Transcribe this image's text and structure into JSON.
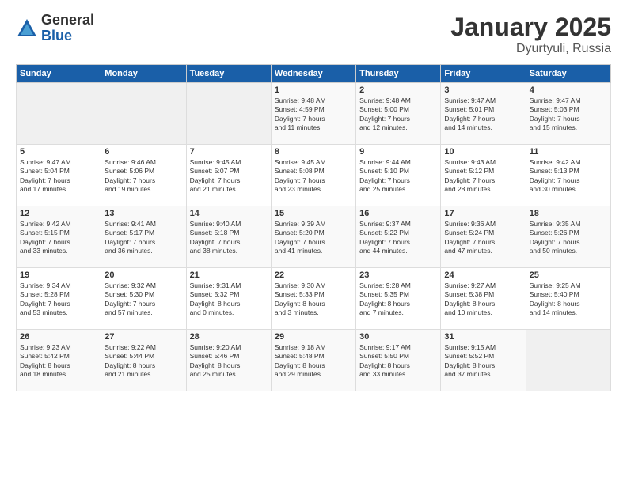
{
  "logo": {
    "general": "General",
    "blue": "Blue"
  },
  "title": "January 2025",
  "location": "Dyurtyuli, Russia",
  "days_header": [
    "Sunday",
    "Monday",
    "Tuesday",
    "Wednesday",
    "Thursday",
    "Friday",
    "Saturday"
  ],
  "weeks": [
    [
      {
        "day": "",
        "content": ""
      },
      {
        "day": "",
        "content": ""
      },
      {
        "day": "",
        "content": ""
      },
      {
        "day": "1",
        "content": "Sunrise: 9:48 AM\nSunset: 4:59 PM\nDaylight: 7 hours\nand 11 minutes."
      },
      {
        "day": "2",
        "content": "Sunrise: 9:48 AM\nSunset: 5:00 PM\nDaylight: 7 hours\nand 12 minutes."
      },
      {
        "day": "3",
        "content": "Sunrise: 9:47 AM\nSunset: 5:01 PM\nDaylight: 7 hours\nand 14 minutes."
      },
      {
        "day": "4",
        "content": "Sunrise: 9:47 AM\nSunset: 5:03 PM\nDaylight: 7 hours\nand 15 minutes."
      }
    ],
    [
      {
        "day": "5",
        "content": "Sunrise: 9:47 AM\nSunset: 5:04 PM\nDaylight: 7 hours\nand 17 minutes."
      },
      {
        "day": "6",
        "content": "Sunrise: 9:46 AM\nSunset: 5:06 PM\nDaylight: 7 hours\nand 19 minutes."
      },
      {
        "day": "7",
        "content": "Sunrise: 9:45 AM\nSunset: 5:07 PM\nDaylight: 7 hours\nand 21 minutes."
      },
      {
        "day": "8",
        "content": "Sunrise: 9:45 AM\nSunset: 5:08 PM\nDaylight: 7 hours\nand 23 minutes."
      },
      {
        "day": "9",
        "content": "Sunrise: 9:44 AM\nSunset: 5:10 PM\nDaylight: 7 hours\nand 25 minutes."
      },
      {
        "day": "10",
        "content": "Sunrise: 9:43 AM\nSunset: 5:12 PM\nDaylight: 7 hours\nand 28 minutes."
      },
      {
        "day": "11",
        "content": "Sunrise: 9:42 AM\nSunset: 5:13 PM\nDaylight: 7 hours\nand 30 minutes."
      }
    ],
    [
      {
        "day": "12",
        "content": "Sunrise: 9:42 AM\nSunset: 5:15 PM\nDaylight: 7 hours\nand 33 minutes."
      },
      {
        "day": "13",
        "content": "Sunrise: 9:41 AM\nSunset: 5:17 PM\nDaylight: 7 hours\nand 36 minutes."
      },
      {
        "day": "14",
        "content": "Sunrise: 9:40 AM\nSunset: 5:18 PM\nDaylight: 7 hours\nand 38 minutes."
      },
      {
        "day": "15",
        "content": "Sunrise: 9:39 AM\nSunset: 5:20 PM\nDaylight: 7 hours\nand 41 minutes."
      },
      {
        "day": "16",
        "content": "Sunrise: 9:37 AM\nSunset: 5:22 PM\nDaylight: 7 hours\nand 44 minutes."
      },
      {
        "day": "17",
        "content": "Sunrise: 9:36 AM\nSunset: 5:24 PM\nDaylight: 7 hours\nand 47 minutes."
      },
      {
        "day": "18",
        "content": "Sunrise: 9:35 AM\nSunset: 5:26 PM\nDaylight: 7 hours\nand 50 minutes."
      }
    ],
    [
      {
        "day": "19",
        "content": "Sunrise: 9:34 AM\nSunset: 5:28 PM\nDaylight: 7 hours\nand 53 minutes."
      },
      {
        "day": "20",
        "content": "Sunrise: 9:32 AM\nSunset: 5:30 PM\nDaylight: 7 hours\nand 57 minutes."
      },
      {
        "day": "21",
        "content": "Sunrise: 9:31 AM\nSunset: 5:32 PM\nDaylight: 8 hours\nand 0 minutes."
      },
      {
        "day": "22",
        "content": "Sunrise: 9:30 AM\nSunset: 5:33 PM\nDaylight: 8 hours\nand 3 minutes."
      },
      {
        "day": "23",
        "content": "Sunrise: 9:28 AM\nSunset: 5:35 PM\nDaylight: 8 hours\nand 7 minutes."
      },
      {
        "day": "24",
        "content": "Sunrise: 9:27 AM\nSunset: 5:38 PM\nDaylight: 8 hours\nand 10 minutes."
      },
      {
        "day": "25",
        "content": "Sunrise: 9:25 AM\nSunset: 5:40 PM\nDaylight: 8 hours\nand 14 minutes."
      }
    ],
    [
      {
        "day": "26",
        "content": "Sunrise: 9:23 AM\nSunset: 5:42 PM\nDaylight: 8 hours\nand 18 minutes."
      },
      {
        "day": "27",
        "content": "Sunrise: 9:22 AM\nSunset: 5:44 PM\nDaylight: 8 hours\nand 21 minutes."
      },
      {
        "day": "28",
        "content": "Sunrise: 9:20 AM\nSunset: 5:46 PM\nDaylight: 8 hours\nand 25 minutes."
      },
      {
        "day": "29",
        "content": "Sunrise: 9:18 AM\nSunset: 5:48 PM\nDaylight: 8 hours\nand 29 minutes."
      },
      {
        "day": "30",
        "content": "Sunrise: 9:17 AM\nSunset: 5:50 PM\nDaylight: 8 hours\nand 33 minutes."
      },
      {
        "day": "31",
        "content": "Sunrise: 9:15 AM\nSunset: 5:52 PM\nDaylight: 8 hours\nand 37 minutes."
      },
      {
        "day": "",
        "content": ""
      }
    ]
  ]
}
